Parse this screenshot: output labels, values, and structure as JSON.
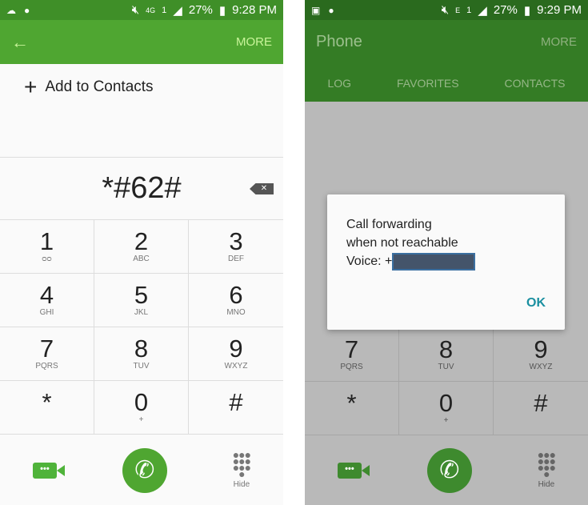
{
  "left": {
    "status": {
      "battery": "27%",
      "time": "9:28 PM",
      "network": "4G",
      "sim": "1"
    },
    "header": {
      "back_icon": "arrow-left-icon",
      "more": "MORE"
    },
    "add_contacts": "Add to Contacts",
    "dialed_number": "*#62#",
    "bottom": {
      "hide": "Hide"
    }
  },
  "right": {
    "status": {
      "battery": "27%",
      "time": "9:29 PM",
      "network": "E",
      "sim": "1"
    },
    "header": {
      "title": "Phone",
      "more": "MORE"
    },
    "tabs": [
      "LOG",
      "FAVORITES",
      "CONTACTS"
    ],
    "dialog": {
      "line1": "Call forwarding",
      "line2": "when not reachable",
      "line3": "Voice: +",
      "ok": "OK"
    },
    "bottom": {
      "hide": "Hide"
    }
  },
  "keys": [
    {
      "d": "1",
      "s": "ᴑᴑ"
    },
    {
      "d": "2",
      "s": "ABC"
    },
    {
      "d": "3",
      "s": "DEF"
    },
    {
      "d": "4",
      "s": "GHI"
    },
    {
      "d": "5",
      "s": "JKL"
    },
    {
      "d": "6",
      "s": "MNO"
    },
    {
      "d": "7",
      "s": "PQRS"
    },
    {
      "d": "8",
      "s": "TUV"
    },
    {
      "d": "9",
      "s": "WXYZ"
    },
    {
      "d": "*",
      "s": ""
    },
    {
      "d": "0",
      "s": "+"
    },
    {
      "d": "#",
      "s": ""
    }
  ],
  "colors": {
    "accent": "#4fa631",
    "ok": "#1a8fa0"
  }
}
